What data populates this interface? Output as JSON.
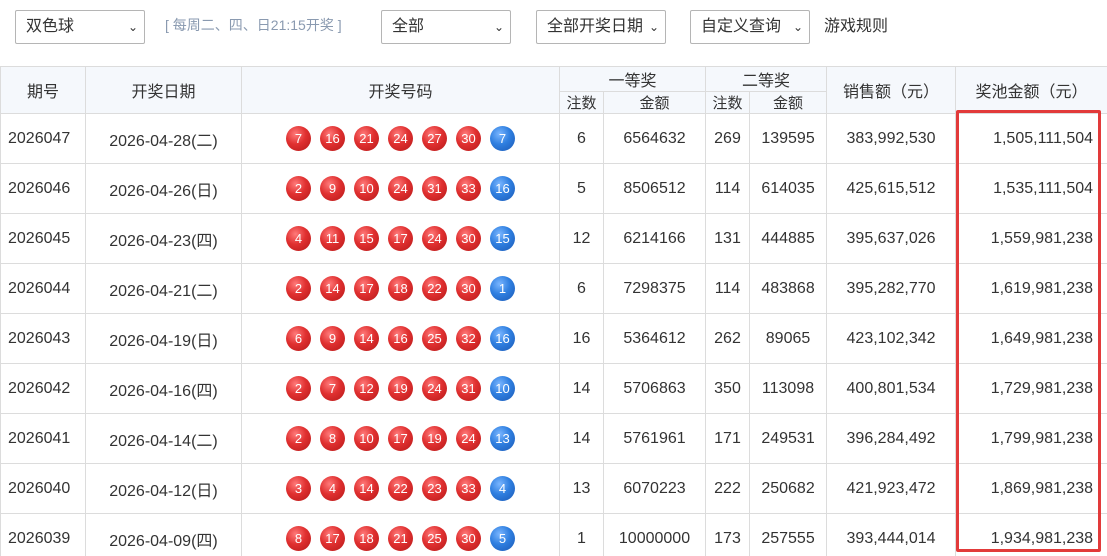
{
  "toolbar": {
    "lottery_select": "双色球",
    "hint": "[ 每周二、四、日21:15开奖 ]",
    "scope_select": "全部",
    "date_select": "全部开奖日期",
    "query_select": "自定义查询",
    "rules_link": "游戏规则"
  },
  "table": {
    "headers": {
      "issue": "期号",
      "date": "开奖日期",
      "numbers": "开奖号码",
      "first_prize": "一等奖",
      "second_prize": "二等奖",
      "count": "注数",
      "amount": "金额",
      "sales": "销售额（元）",
      "pool": "奖池金额（元）"
    },
    "rows": [
      {
        "issue": "2026047",
        "date": "2026-04-28(二)",
        "red": [
          "7",
          "16",
          "21",
          "24",
          "27",
          "30"
        ],
        "blue": "7",
        "c1": "6",
        "a1": "6564632",
        "c2": "269",
        "a2": "139595",
        "sales": "383,992,530",
        "pool": "1,505,111,504"
      },
      {
        "issue": "2026046",
        "date": "2026-04-26(日)",
        "red": [
          "2",
          "9",
          "10",
          "24",
          "31",
          "33"
        ],
        "blue": "16",
        "c1": "5",
        "a1": "8506512",
        "c2": "114",
        "a2": "614035",
        "sales": "425,615,512",
        "pool": "1,535,111,504"
      },
      {
        "issue": "2026045",
        "date": "2026-04-23(四)",
        "red": [
          "4",
          "11",
          "15",
          "17",
          "24",
          "30"
        ],
        "blue": "15",
        "c1": "12",
        "a1": "6214166",
        "c2": "131",
        "a2": "444885",
        "sales": "395,637,026",
        "pool": "1,559,981,238"
      },
      {
        "issue": "2026044",
        "date": "2026-04-21(二)",
        "red": [
          "2",
          "14",
          "17",
          "18",
          "22",
          "30"
        ],
        "blue": "1",
        "c1": "6",
        "a1": "7298375",
        "c2": "114",
        "a2": "483868",
        "sales": "395,282,770",
        "pool": "1,619,981,238"
      },
      {
        "issue": "2026043",
        "date": "2026-04-19(日)",
        "red": [
          "6",
          "9",
          "14",
          "16",
          "25",
          "32"
        ],
        "blue": "16",
        "c1": "16",
        "a1": "5364612",
        "c2": "262",
        "a2": "89065",
        "sales": "423,102,342",
        "pool": "1,649,981,238"
      },
      {
        "issue": "2026042",
        "date": "2026-04-16(四)",
        "red": [
          "2",
          "7",
          "12",
          "19",
          "24",
          "31"
        ],
        "blue": "10",
        "c1": "14",
        "a1": "5706863",
        "c2": "350",
        "a2": "113098",
        "sales": "400,801,534",
        "pool": "1,729,981,238"
      },
      {
        "issue": "2026041",
        "date": "2026-04-14(二)",
        "red": [
          "2",
          "8",
          "10",
          "17",
          "19",
          "24"
        ],
        "blue": "13",
        "c1": "14",
        "a1": "5761961",
        "c2": "171",
        "a2": "249531",
        "sales": "396,284,492",
        "pool": "1,799,981,238"
      },
      {
        "issue": "2026040",
        "date": "2026-04-12(日)",
        "red": [
          "3",
          "4",
          "14",
          "22",
          "23",
          "33"
        ],
        "blue": "4",
        "c1": "13",
        "a1": "6070223",
        "c2": "222",
        "a2": "250682",
        "sales": "421,923,472",
        "pool": "1,869,981,238"
      },
      {
        "issue": "2026039",
        "date": "2026-04-09(四)",
        "red": [
          "8",
          "17",
          "18",
          "21",
          "25",
          "30"
        ],
        "blue": "5",
        "c1": "1",
        "a1": "10000000",
        "c2": "173",
        "a2": "257555",
        "sales": "393,444,014",
        "pool": "1,934,981,238"
      }
    ]
  },
  "colors": {
    "red_ball": "#e03030",
    "blue_ball": "#2f7fe0",
    "highlight_border": "#e23a3a",
    "header_bg": "#f5f8fc"
  },
  "icons": {
    "select_arrow": "chevron-down-icon",
    "ball_red": "red-ball-icon",
    "ball_blue": "blue-ball-icon"
  }
}
